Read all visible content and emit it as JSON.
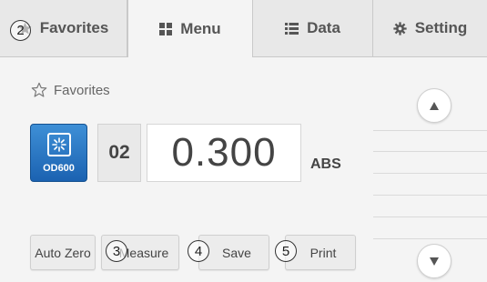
{
  "tabs": [
    {
      "label": "Favorites",
      "icon": "star-icon",
      "callout": "2"
    },
    {
      "label": "Menu",
      "icon": "grid-icon"
    },
    {
      "label": "Data",
      "icon": "list-icon"
    },
    {
      "label": "Setting",
      "icon": "gear-icon"
    }
  ],
  "favorites": {
    "title": "Favorites",
    "icon": "star-outline-icon"
  },
  "measurement": {
    "mode_label": "OD600",
    "mode_icon": "od600-icon",
    "slot": "02",
    "value": "0.300",
    "unit": "ABS"
  },
  "actions": {
    "auto_zero": "Auto Zero",
    "measure": "Measure",
    "save": "Save",
    "print": "Print"
  },
  "callouts": {
    "measure": "3",
    "save": "4",
    "print": "5"
  },
  "scroll": {
    "up_icon": "triangle-up-icon",
    "down_icon": "triangle-down-icon"
  },
  "colors": {
    "accent": "#1f6bbf",
    "background": "#f4f4f4"
  }
}
